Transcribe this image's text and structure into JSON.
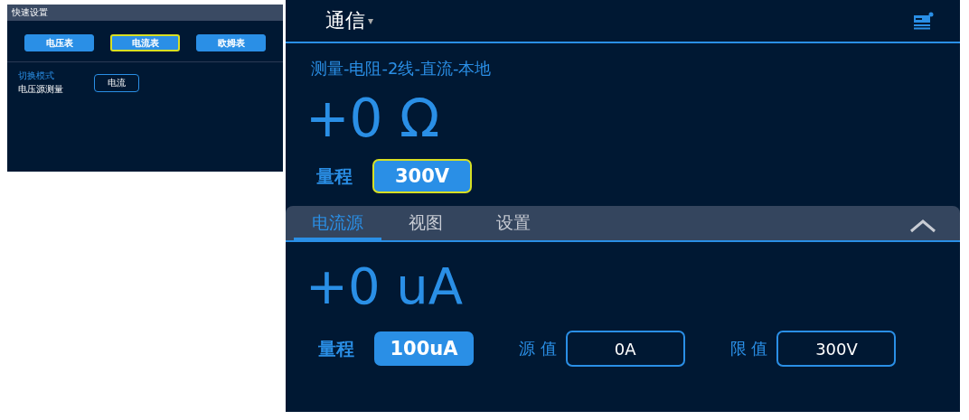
{
  "quick_settings": {
    "title": "快速设置",
    "meter_buttons": [
      {
        "label": "电压表",
        "selected": false
      },
      {
        "label": "电流表",
        "selected": true
      },
      {
        "label": "欧姆表",
        "selected": false
      }
    ],
    "mode_label": "切换模式",
    "mode_sub": "电压源测量",
    "mode_button": "电流"
  },
  "main": {
    "header": {
      "title": "通信",
      "dropdown": "▾"
    },
    "function": "测量-电阻-2线-直流-本地",
    "reading": "+0 Ω",
    "range": {
      "label": "量程",
      "value": "300V",
      "focused": true
    },
    "tabs": [
      {
        "label": "电流源",
        "selected": true
      },
      {
        "label": "视图",
        "selected": false
      },
      {
        "label": "设置",
        "selected": false
      }
    ],
    "source": {
      "reading": "+0 uA",
      "range": {
        "label": "量程",
        "value": "100uA",
        "focused": false
      },
      "source_value": {
        "label": "源 值",
        "value": "0A"
      },
      "limit_value": {
        "label": "限 值",
        "value": "300V"
      }
    }
  }
}
